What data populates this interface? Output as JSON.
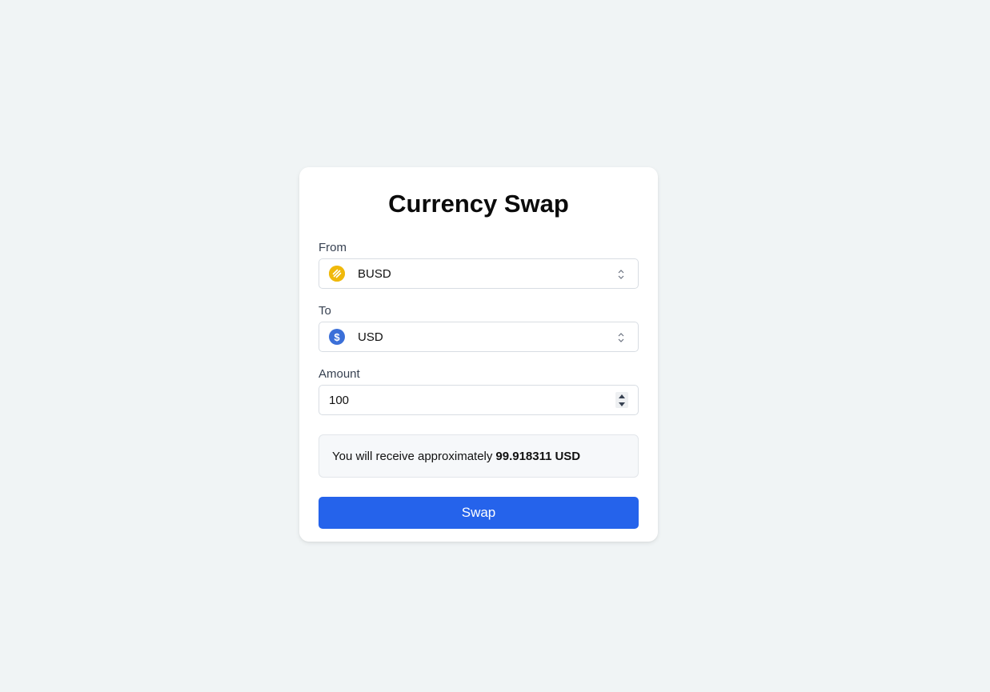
{
  "app": {
    "title": "Currency Swap"
  },
  "form": {
    "from": {
      "label": "From",
      "selected": "BUSD",
      "icon": "busd-coin-icon",
      "icon_color": "#f0b90b"
    },
    "to": {
      "label": "To",
      "selected": "USD",
      "icon": "usd-coin-icon",
      "icon_glyph": "$",
      "icon_color": "#3b6fd8"
    },
    "amount": {
      "label": "Amount",
      "value": "100"
    }
  },
  "result": {
    "prefix": "You will receive approximately",
    "amount": "99.918311",
    "currency": "USD"
  },
  "actions": {
    "swap_label": "Swap",
    "swap_color": "#2563eb"
  }
}
